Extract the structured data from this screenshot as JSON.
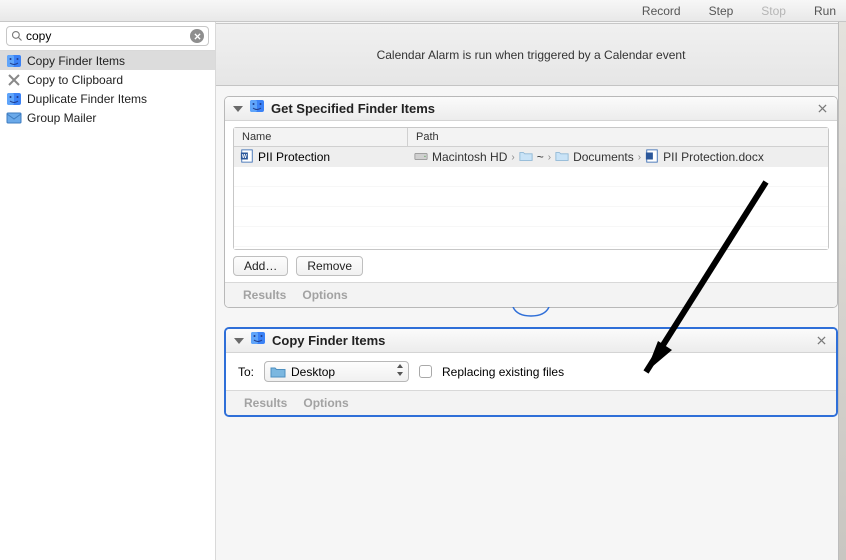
{
  "toolbar": {
    "record": "Record",
    "step": "Step",
    "stop": "Stop",
    "run": "Run"
  },
  "search": {
    "value": "copy"
  },
  "actions": [
    {
      "label": "Copy Finder Items",
      "icon": "finder",
      "selected": true
    },
    {
      "label": "Copy to Clipboard",
      "icon": "clipboard"
    },
    {
      "label": "Duplicate Finder Items",
      "icon": "finder"
    },
    {
      "label": "Group Mailer",
      "icon": "mail"
    }
  ],
  "info_bar": "Calendar Alarm is run when triggered by a Calendar event",
  "block1": {
    "title": "Get Specified Finder Items",
    "col_name": "Name",
    "col_path": "Path",
    "row": {
      "name": "PII Protection",
      "path": [
        "Macintosh HD",
        "~",
        "Documents",
        "PII Protection.docx"
      ]
    },
    "add": "Add…",
    "remove": "Remove",
    "results": "Results",
    "options": "Options"
  },
  "block2": {
    "title": "Copy Finder Items",
    "to_label": "To:",
    "dest": "Desktop",
    "replace_label": "Replacing existing files",
    "results": "Results",
    "options": "Options"
  }
}
